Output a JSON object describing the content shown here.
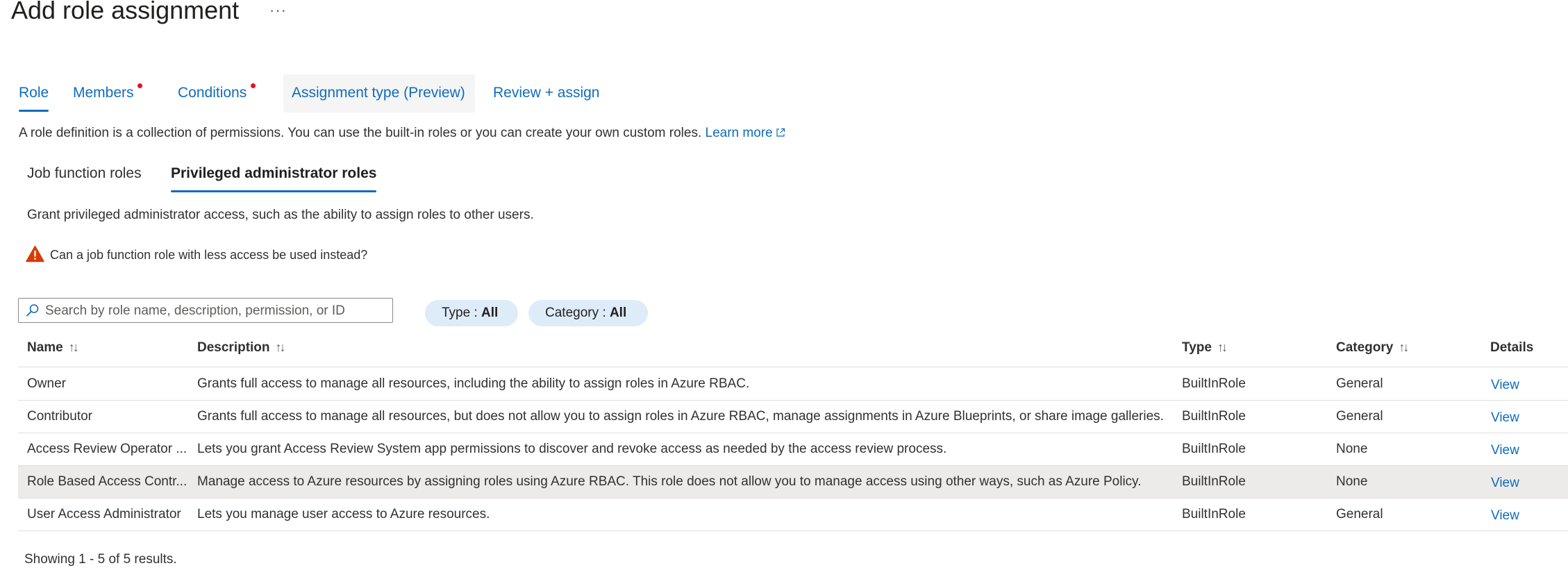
{
  "page": {
    "title": "Add role assignment",
    "more": "···"
  },
  "tabs": [
    {
      "label": "Role",
      "active": true
    },
    {
      "label": "Members",
      "has_dot": true
    },
    {
      "label": "Conditions",
      "has_dot": true
    },
    {
      "label": "Assignment type (Preview)"
    },
    {
      "label": "Review + assign"
    }
  ],
  "intro": {
    "text": "A role definition is a collection of permissions. You can use the built-in roles or you can create your own custom roles.",
    "link": "Learn more"
  },
  "sub_tabs": [
    {
      "label": "Job function roles"
    },
    {
      "label": "Privileged administrator roles",
      "active": true
    }
  ],
  "grant_text": "Grant privileged administrator access, such as the ability to assign roles to other users.",
  "warning": {
    "text": "Can a job function role with less access be used instead?",
    "icon": "warning-icon",
    "color": "#d83b01"
  },
  "search": {
    "placeholder": "Search by role name, description, permission, or ID",
    "value": ""
  },
  "filters": [
    {
      "label": "Type : ",
      "value": "All"
    },
    {
      "label": "Category : ",
      "value": "All"
    }
  ],
  "table": {
    "columns": [
      "Name",
      "Description",
      "Type",
      "Category",
      "Details"
    ],
    "rows": [
      {
        "name": "Owner",
        "description": "Grants full access to manage all resources, including the ability to assign roles in Azure RBAC.",
        "type": "BuiltInRole",
        "category": "General",
        "details": "View"
      },
      {
        "name": "Contributor",
        "description": "Grants full access to manage all resources, but does not allow you to assign roles in Azure RBAC, manage assignments in Azure Blueprints, or share image galleries.",
        "type": "BuiltInRole",
        "category": "General",
        "details": "View"
      },
      {
        "name": "Access Review Operator ...",
        "description": "Lets you grant Access Review System app permissions to discover and revoke access as needed by the access review process.",
        "type": "BuiltInRole",
        "category": "None",
        "details": "View"
      },
      {
        "name": "Role Based Access Contr...",
        "description": "Manage access to Azure resources by assigning roles using Azure RBAC. This role does not allow you to manage access using other ways, such as Azure Policy.",
        "type": "BuiltInRole",
        "category": "None",
        "details": "View",
        "selected": true
      },
      {
        "name": "User Access Administrator",
        "description": "Lets you manage user access to Azure resources.",
        "type": "BuiltInRole",
        "category": "General",
        "details": "View"
      }
    ]
  },
  "footer": "Showing 1 - 5 of 5 results.",
  "colors": {
    "accent": "#0f6cbd",
    "dot": "#e81123",
    "pill_bg": "#deecf9",
    "selected_row": "#edebe9"
  }
}
